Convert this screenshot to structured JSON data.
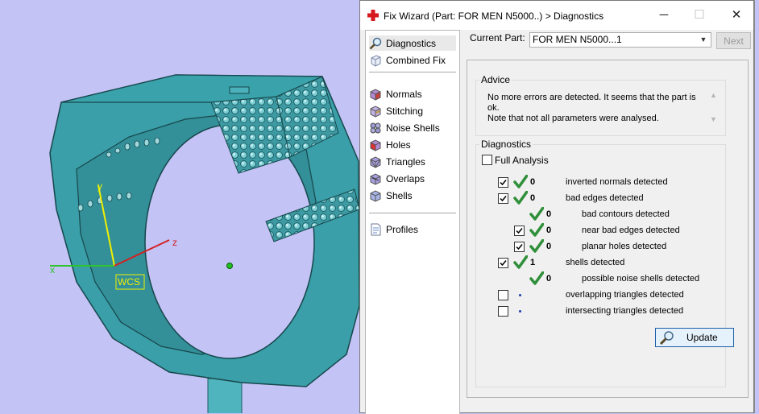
{
  "viewport": {
    "axis_x": "x",
    "axis_y": "y",
    "axis_z": "z",
    "wcs_label": "WCS"
  },
  "dialog": {
    "title": "Fix Wizard (Part: FOR MEN N5000..) > Diagnostics",
    "controls": {
      "minimize": "─",
      "maximize": "☐",
      "close": "✕"
    }
  },
  "nav": {
    "items": [
      {
        "label": "Diagnostics",
        "icon": "magnifier-icon"
      },
      {
        "label": "Combined Fix",
        "icon": "cube-icon"
      },
      {
        "label": "Normals",
        "icon": "normals-cube-icon"
      },
      {
        "label": "Stitching",
        "icon": "stitching-cube-icon"
      },
      {
        "label": "Noise Shells",
        "icon": "noise-shells-icon"
      },
      {
        "label": "Holes",
        "icon": "holes-cube-icon"
      },
      {
        "label": "Triangles",
        "icon": "triangles-cube-icon"
      },
      {
        "label": "Overlaps",
        "icon": "overlaps-cube-icon"
      },
      {
        "label": "Shells",
        "icon": "shells-cube-icon"
      },
      {
        "label": "Profiles",
        "icon": "document-icon"
      }
    ],
    "selected": "Diagnostics"
  },
  "part": {
    "label": "Current Part:",
    "value": "FOR MEN N5000...1",
    "next_label": "Next"
  },
  "advice": {
    "title": "Advice",
    "text": "No more errors are detected. It seems that the part is ok.\nNote that not all parameters were analysed."
  },
  "diagnostics": {
    "title": "Diagnostics",
    "full_analysis_label": "Full Analysis",
    "full_analysis_checked": false,
    "rows": [
      {
        "checkbox": true,
        "checked": true,
        "status": "ok",
        "count": "0",
        "label": "inverted normals detected"
      },
      {
        "checkbox": true,
        "checked": true,
        "status": "ok",
        "count": "0",
        "label": "bad edges detected"
      },
      {
        "checkbox": false,
        "checked": false,
        "status": "ok",
        "count": "0",
        "label": "bad contours detected"
      },
      {
        "checkbox": true,
        "checked": true,
        "status": "ok",
        "count": "0",
        "label": "near bad edges detected"
      },
      {
        "checkbox": true,
        "checked": true,
        "status": "ok",
        "count": "0",
        "label": "planar holes detected"
      },
      {
        "checkbox": true,
        "checked": true,
        "status": "ok",
        "count": "1",
        "label": "shells detected"
      },
      {
        "checkbox": false,
        "checked": false,
        "status": "ok",
        "count": "0",
        "label": "possible noise shells detected"
      },
      {
        "checkbox": true,
        "checked": false,
        "status": "pending",
        "count": "",
        "label": "overlapping triangles detected"
      },
      {
        "checkbox": true,
        "checked": false,
        "status": "pending",
        "count": "",
        "label": "intersecting triangles detected"
      }
    ],
    "update_label": "Update"
  },
  "colors": {
    "viewport_bg": "#c3c3f6",
    "ring": "#3a9fa8",
    "ok_tick": "#2f8f3a",
    "pending_dot": "#1a3fa8",
    "axis_x": "#2ec42e",
    "axis_y": "#f0f000",
    "axis_z": "#d42020"
  }
}
